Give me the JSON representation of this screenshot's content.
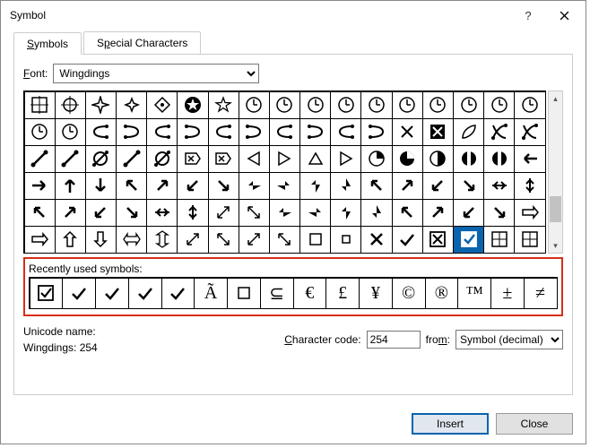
{
  "title": "Symbol",
  "tabs": {
    "symbols": "Symbols",
    "special": "Special Characters"
  },
  "font": {
    "label": "Font:",
    "value": "Wingdings"
  },
  "grid": {
    "cols": 17,
    "rows": 6,
    "selected_index": 100
  },
  "recent": {
    "label": "Recently used symbols:"
  },
  "unicode": {
    "label": "Unicode name:",
    "value": "Wingdings: 254"
  },
  "code": {
    "label": "Character code:",
    "value": "254"
  },
  "from": {
    "label": "from:",
    "value": "Symbol (decimal)"
  },
  "buttons": {
    "insert": "Insert",
    "close": "Close"
  }
}
